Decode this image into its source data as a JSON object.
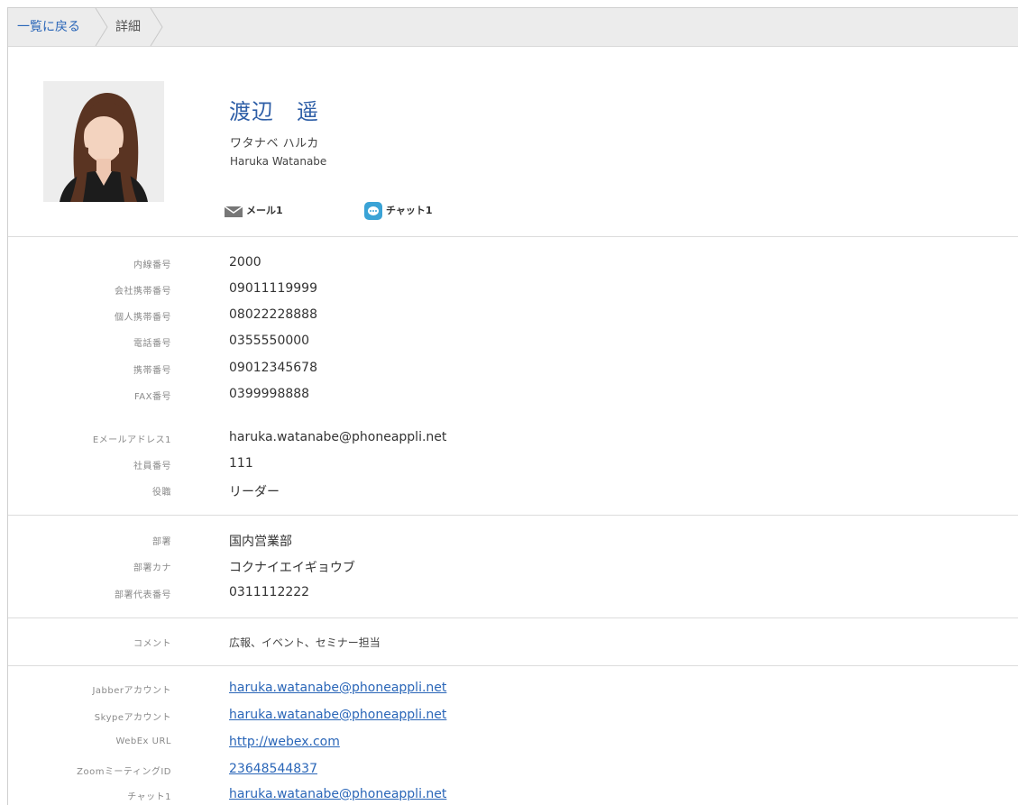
{
  "breadcrumb": {
    "back_label": "一覧に戻る",
    "current_label": "詳細"
  },
  "profile": {
    "name": "渡辺　遥",
    "kana": "ワタナベ ハルカ",
    "name_en": "Haruka Watanabe",
    "actions": {
      "mail_label": "メール1",
      "chat_label": "チャット1"
    }
  },
  "section_phone": [
    {
      "label": "内線番号",
      "value": "2000"
    },
    {
      "label": "会社携帯番号",
      "value": "09011119999"
    },
    {
      "label": "個人携帯番号",
      "value": "08022228888"
    },
    {
      "label": "電話番号",
      "value": "0355550000"
    },
    {
      "label": "携帯番号",
      "value": "09012345678"
    },
    {
      "label": "FAX番号",
      "value": "0399998888"
    }
  ],
  "section_info": [
    {
      "label": "Eメールアドレス1",
      "value": "haruka.watanabe@phoneappli.net"
    },
    {
      "label": "社員番号",
      "value": "111"
    },
    {
      "label": "役職",
      "value": "リーダー"
    }
  ],
  "section_dept": [
    {
      "label": "部署",
      "value": "国内営業部"
    },
    {
      "label": "部署カナ",
      "value": "コクナイエイギョウブ"
    },
    {
      "label": "部署代表番号",
      "value": "0311112222"
    }
  ],
  "section_comment": {
    "label": "コメント",
    "value": "広報、イベント、セミナー担当"
  },
  "section_accounts": [
    {
      "label": "Jabberアカウント",
      "value": "haruka.watanabe@phoneappli.net"
    },
    {
      "label": "Skypeアカウント",
      "value": "haruka.watanabe@phoneappli.net"
    },
    {
      "label": "WebEx URL",
      "value": "http://webex.com"
    },
    {
      "label": "ZoomミーティングID",
      "value": "23648544837"
    },
    {
      "label": "チャット1",
      "value": "haruka.watanabe@phoneappli.net"
    }
  ],
  "colors": {
    "link": "#2a66b8",
    "name": "#2f5fa7",
    "chat_icon": "#3aa3d6",
    "crumb_bg": "#ececec"
  }
}
